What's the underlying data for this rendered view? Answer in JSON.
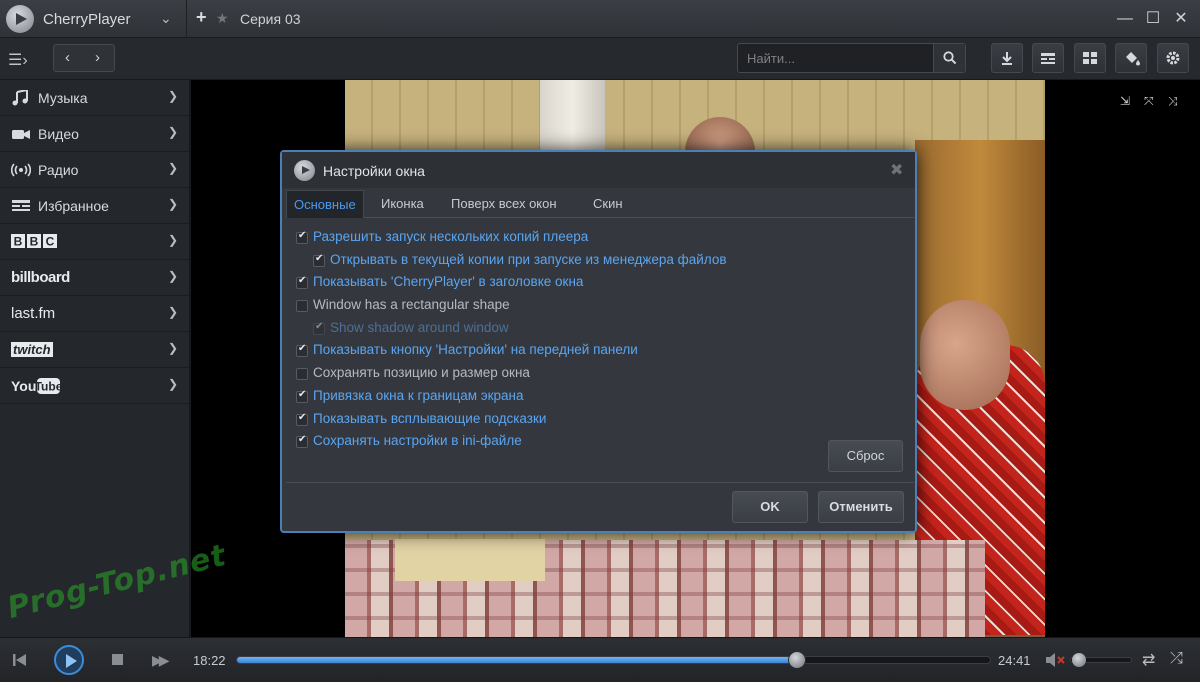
{
  "app": {
    "name": "CherryPlayer",
    "tab_title": "Серия 03"
  },
  "toolbar": {
    "search_placeholder": "Найти..."
  },
  "sidebar": {
    "items": [
      {
        "label": "Музыка",
        "icon": "music-note-icon"
      },
      {
        "label": "Видео",
        "icon": "video-camera-icon"
      },
      {
        "label": "Радио",
        "icon": "radio-waves-icon"
      },
      {
        "label": "Избранное",
        "icon": "favorites-icon"
      },
      {
        "label": "BBC",
        "icon": "bbc-logo"
      },
      {
        "label": "billboard",
        "icon": "billboard-logo"
      },
      {
        "label": "last.fm",
        "icon": "lastfm-logo"
      },
      {
        "label": "twitch",
        "icon": "twitch-logo"
      },
      {
        "label": "YouTube",
        "icon": "youtube-logo"
      }
    ]
  },
  "dialog": {
    "title": "Настройки окна",
    "tabs": [
      "Основные",
      "Иконка",
      "Поверх всех окон",
      "Скин"
    ],
    "active_tab": "Основные",
    "options": [
      {
        "label": "Разрешить запуск нескольких копий плеера",
        "checked": true,
        "indent": false,
        "enabled": true
      },
      {
        "label": "Открывать в текущей копии при запуске из менеджера файлов",
        "checked": true,
        "indent": true,
        "enabled": true
      },
      {
        "label": "Показывать 'CherryPlayer' в заголовке окна",
        "checked": true,
        "indent": false,
        "enabled": true
      },
      {
        "label": "Window has a rectangular shape",
        "checked": false,
        "indent": false,
        "enabled": true
      },
      {
        "label": "Show shadow around window",
        "checked": true,
        "indent": true,
        "enabled": false
      },
      {
        "label": "Показывать кнопку 'Настройки' на передней панели",
        "checked": true,
        "indent": false,
        "enabled": true
      },
      {
        "label": "Сохранять позицию и размер окна",
        "checked": false,
        "indent": false,
        "enabled": true
      },
      {
        "label": "Привязка окна к границам экрана",
        "checked": true,
        "indent": false,
        "enabled": true
      },
      {
        "label": "Показывать всплывающие подсказки",
        "checked": true,
        "indent": false,
        "enabled": true
      },
      {
        "label": "Сохранять настройки в ini-файле",
        "checked": true,
        "indent": false,
        "enabled": true
      }
    ],
    "reset_label": "Сброс",
    "ok_label": "OK",
    "cancel_label": "Отменить"
  },
  "player": {
    "time_current": "18:22",
    "time_total": "24:41",
    "progress_fraction": 0.744,
    "volume_fraction": 0.1,
    "muted": true
  },
  "watermark": "Prog-Top.net",
  "colors": {
    "accent": "#4a9aef",
    "dialog_border": "#4a7fb8",
    "checked_text": "#5aa5f2"
  }
}
